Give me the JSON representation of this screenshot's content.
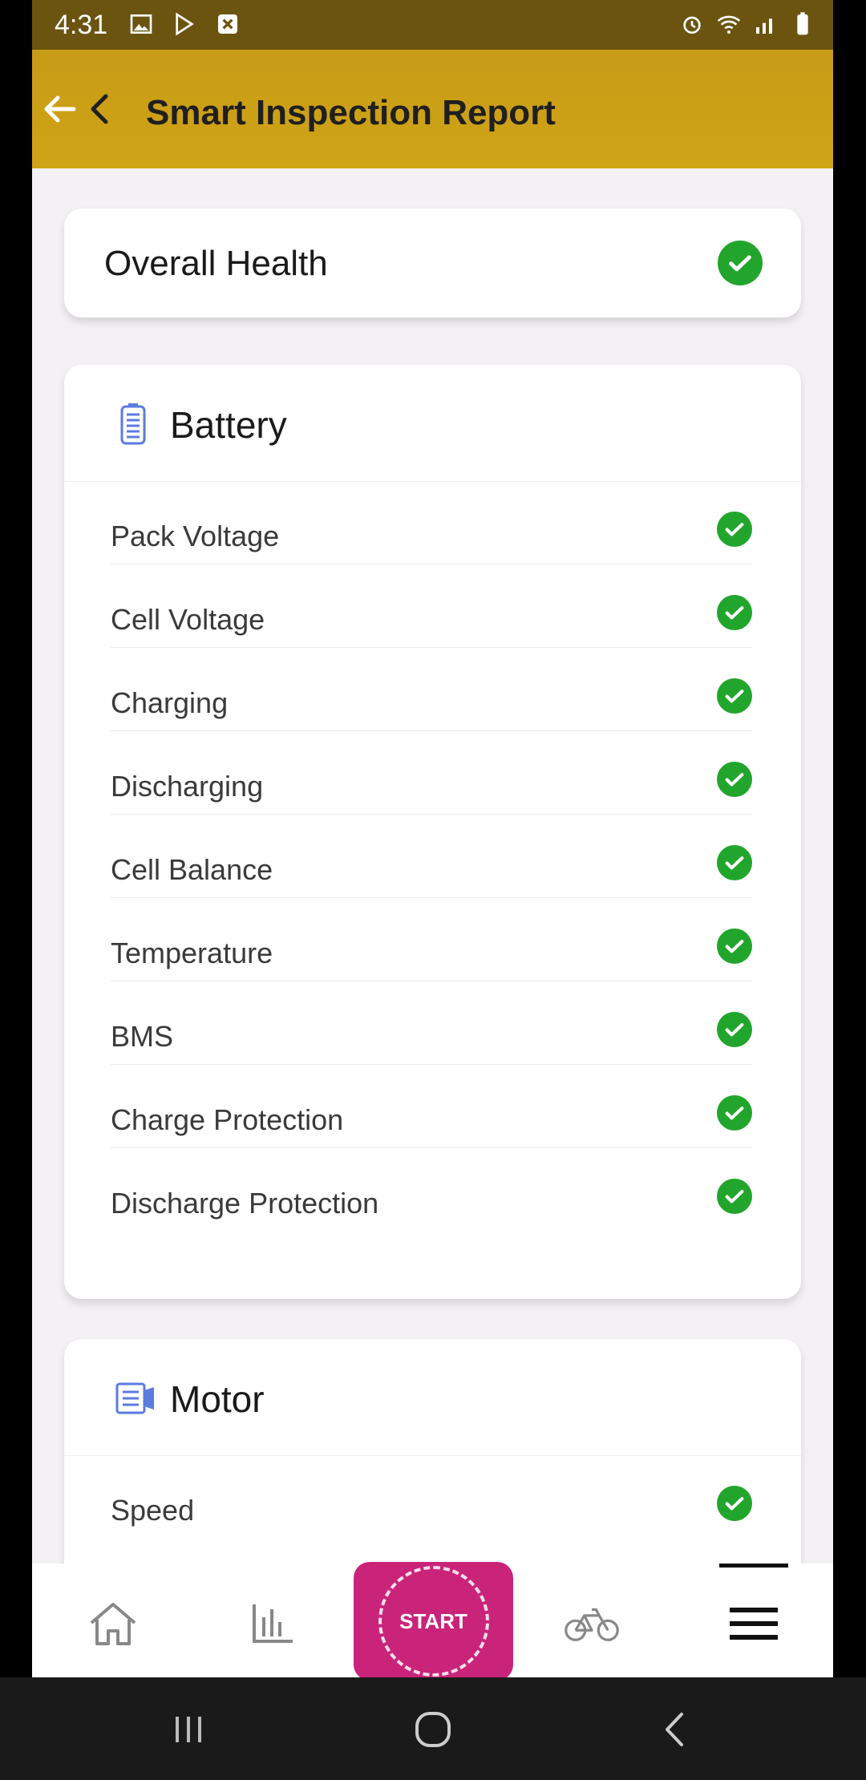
{
  "status_bar": {
    "time": "4:31",
    "left_icons": [
      "image-icon",
      "play-store-icon",
      "close-box-icon"
    ],
    "right_icons": [
      "alarm-icon",
      "wifi-icon",
      "signal-icon",
      "battery-icon"
    ]
  },
  "app_bar": {
    "title": "Smart Inspection Report",
    "back_icon": "back-arrow-icon"
  },
  "overall": {
    "label": "Overall Health",
    "status": "ok"
  },
  "battery": {
    "title": "Battery",
    "icon": "battery-icon",
    "items": [
      {
        "label": "Pack Voltage",
        "status": "ok"
      },
      {
        "label": "Cell Voltage",
        "status": "ok"
      },
      {
        "label": "Charging",
        "status": "ok"
      },
      {
        "label": "Discharging",
        "status": "ok"
      },
      {
        "label": "Cell Balance",
        "status": "ok"
      },
      {
        "label": "Temperature",
        "status": "ok"
      },
      {
        "label": "BMS",
        "status": "ok"
      },
      {
        "label": "Charge Protection",
        "status": "ok"
      },
      {
        "label": "Discharge Protection",
        "status": "ok"
      }
    ]
  },
  "motor": {
    "title": "Motor",
    "icon": "motor-icon",
    "items": [
      {
        "label": "Speed",
        "status": "ok"
      }
    ]
  },
  "bottom_nav": {
    "items": [
      "home-icon",
      "stats-icon",
      "start",
      "bike-icon",
      "menu-icon"
    ],
    "start_label": "START"
  },
  "colors": {
    "accent": "#d0a417",
    "start_button": "#c9247a",
    "check": "#22a52c"
  }
}
